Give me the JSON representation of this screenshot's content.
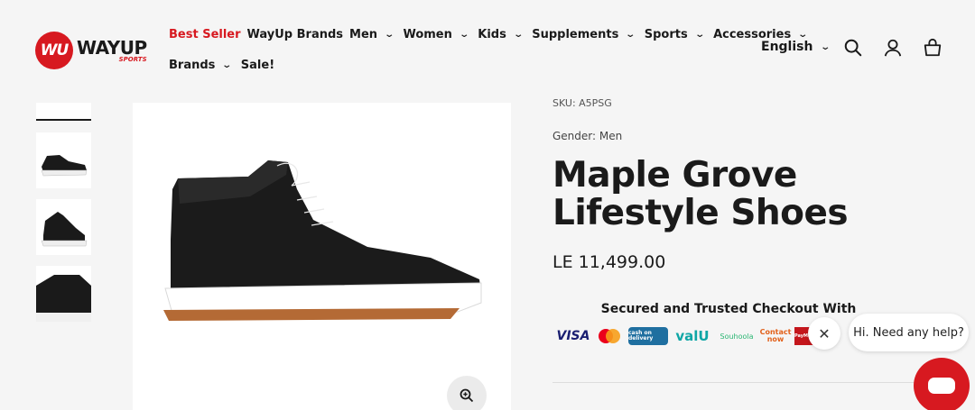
{
  "brand": {
    "logo_mark": "WU",
    "name": "WAYUP",
    "sub": "SPORTS",
    "color": "#d71920"
  },
  "nav": {
    "row1": [
      {
        "label": "Best Seller",
        "highlight": true,
        "dropdown": false
      },
      {
        "label": "WayUp Brands",
        "highlight": false,
        "dropdown": false
      },
      {
        "label": "Men",
        "highlight": false,
        "dropdown": true
      },
      {
        "label": "Women",
        "highlight": false,
        "dropdown": true
      },
      {
        "label": "Kids",
        "highlight": false,
        "dropdown": true
      },
      {
        "label": "Supplements",
        "highlight": false,
        "dropdown": true
      },
      {
        "label": "Sports",
        "highlight": false,
        "dropdown": true
      },
      {
        "label": "Accessories",
        "highlight": false,
        "dropdown": true
      }
    ],
    "row2": [
      {
        "label": "Brands",
        "highlight": false,
        "dropdown": true
      },
      {
        "label": "Sale!",
        "highlight": false,
        "dropdown": false
      }
    ]
  },
  "header": {
    "language": "English",
    "icons": [
      "search-icon",
      "account-icon",
      "cart-icon"
    ]
  },
  "product": {
    "sku": "SKU: A5PSG",
    "gender": "Gender: Men",
    "title": "Maple Grove Lifestyle Shoes",
    "price": "LE 11,499.00",
    "secure_heading": "Secured and Trusted Checkout With",
    "payment_methods": [
      "VISA",
      "Mastercard",
      "cash on delivery",
      "valU",
      "Souhoola",
      "Contact now",
      "PayMob",
      "a"
    ],
    "below_divider": "(partially visible)"
  },
  "chat": {
    "greeting": "Hi. Need any help?"
  }
}
